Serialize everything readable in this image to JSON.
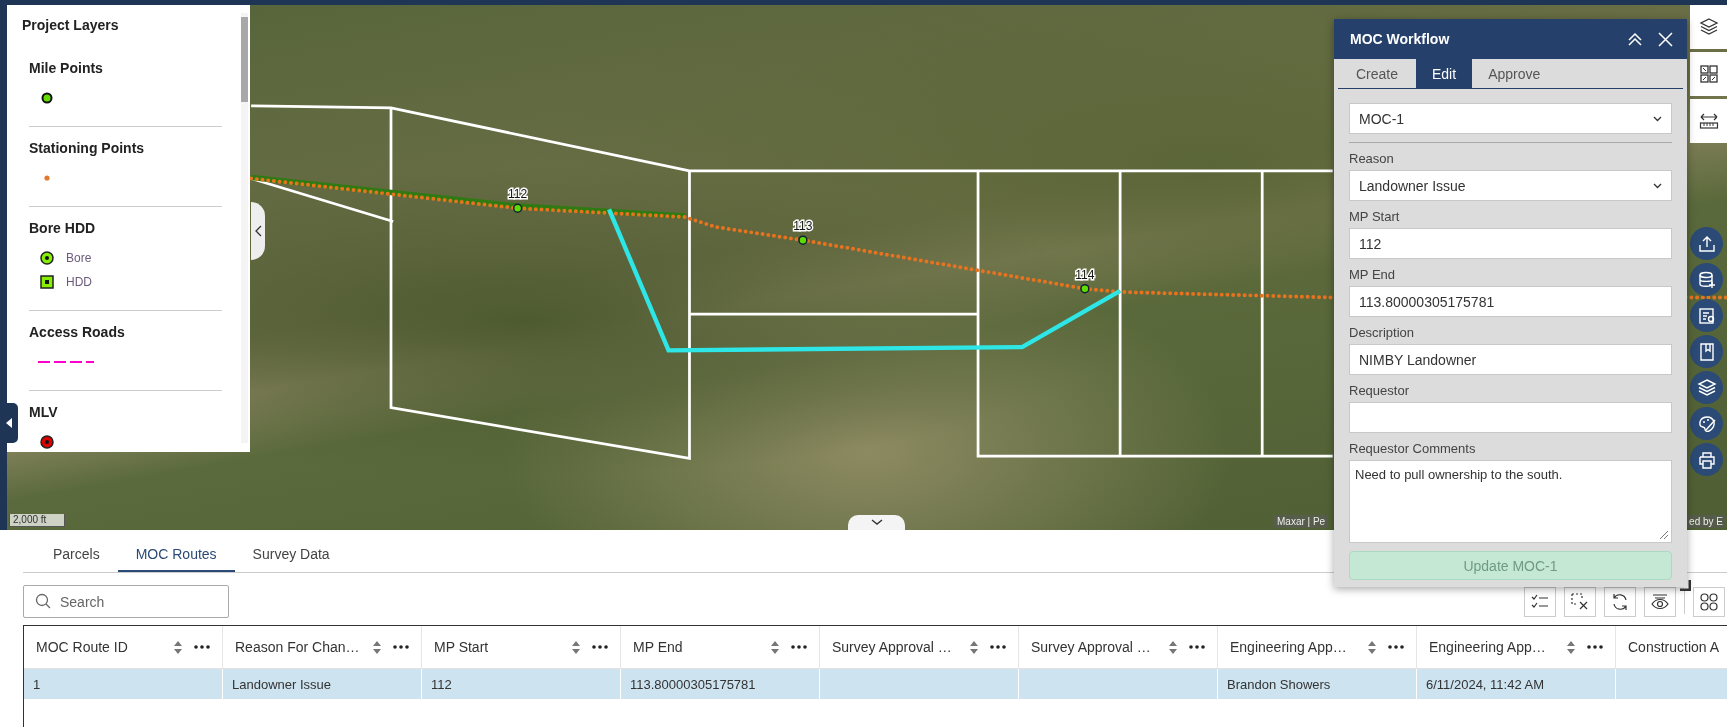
{
  "layers_panel": {
    "title": "Project Layers",
    "sections": [
      {
        "title": "Mile Points",
        "items": [
          {
            "kind": "ring-dot",
            "color": "#66dd00"
          }
        ]
      },
      {
        "title": "Stationing Points",
        "items": [
          {
            "kind": "dot",
            "color": "#e07a30"
          }
        ]
      },
      {
        "title": "Bore HDD",
        "items": [
          {
            "kind": "target-circle",
            "color": "#88ee00",
            "label": "Bore"
          },
          {
            "kind": "target-square",
            "color": "#88ee00",
            "label": "HDD"
          }
        ]
      },
      {
        "title": "Access Roads",
        "items": [
          {
            "kind": "dashed-line",
            "color": "#ff00cc"
          }
        ]
      },
      {
        "title": "MLV",
        "items": [
          {
            "kind": "target-circle",
            "color": "#dd0000"
          }
        ]
      }
    ]
  },
  "map": {
    "mile_points": [
      {
        "label": "112"
      },
      {
        "label": "113"
      },
      {
        "label": "114"
      }
    ],
    "scale_bar": "2,000 ft",
    "attribution_left": "Maxar | Pe",
    "attribution_right": "ed by E"
  },
  "moc_workflow": {
    "title": "MOC Workflow",
    "tabs": [
      {
        "label": "Create",
        "selected": false
      },
      {
        "label": "Edit",
        "selected": true
      },
      {
        "label": "Approve",
        "selected": false
      }
    ],
    "record_select": "MOC-1",
    "fields": [
      {
        "label": "Reason",
        "kind": "select",
        "value": "Landowner Issue"
      },
      {
        "label": "MP Start",
        "kind": "input",
        "value": "112"
      },
      {
        "label": "MP End",
        "kind": "input",
        "value": "113.80000305175781"
      },
      {
        "label": "Description",
        "kind": "input",
        "value": "NIMBY Landowner"
      },
      {
        "label": "Requestor",
        "kind": "input"
      },
      {
        "label": "Requestor Comments",
        "kind": "textarea",
        "value": "Need to pull ownership to the south."
      }
    ],
    "submit": {
      "label": "Update MOC-1",
      "disabled": true
    }
  },
  "bottom_tabs": [
    {
      "label": "Parcels",
      "selected": false
    },
    {
      "label": "MOC Routes",
      "selected": true
    },
    {
      "label": "Survey Data",
      "selected": false
    }
  ],
  "search": {
    "placeholder": "Search"
  },
  "table": {
    "columns": [
      "MOC Route ID",
      "Reason For Chan…",
      "MP Start",
      "MP End",
      "Survey Approval …",
      "Survey Approval …",
      "Engineering App…",
      "Engineering App…",
      "Construction A"
    ],
    "rows": [
      {
        "selected": true,
        "cells": [
          "1",
          "Landowner Issue",
          "112",
          "113.80000305175781",
          null,
          null,
          "Brandon Showers",
          "6/11/2024, 11:42 AM",
          null
        ]
      }
    ]
  }
}
